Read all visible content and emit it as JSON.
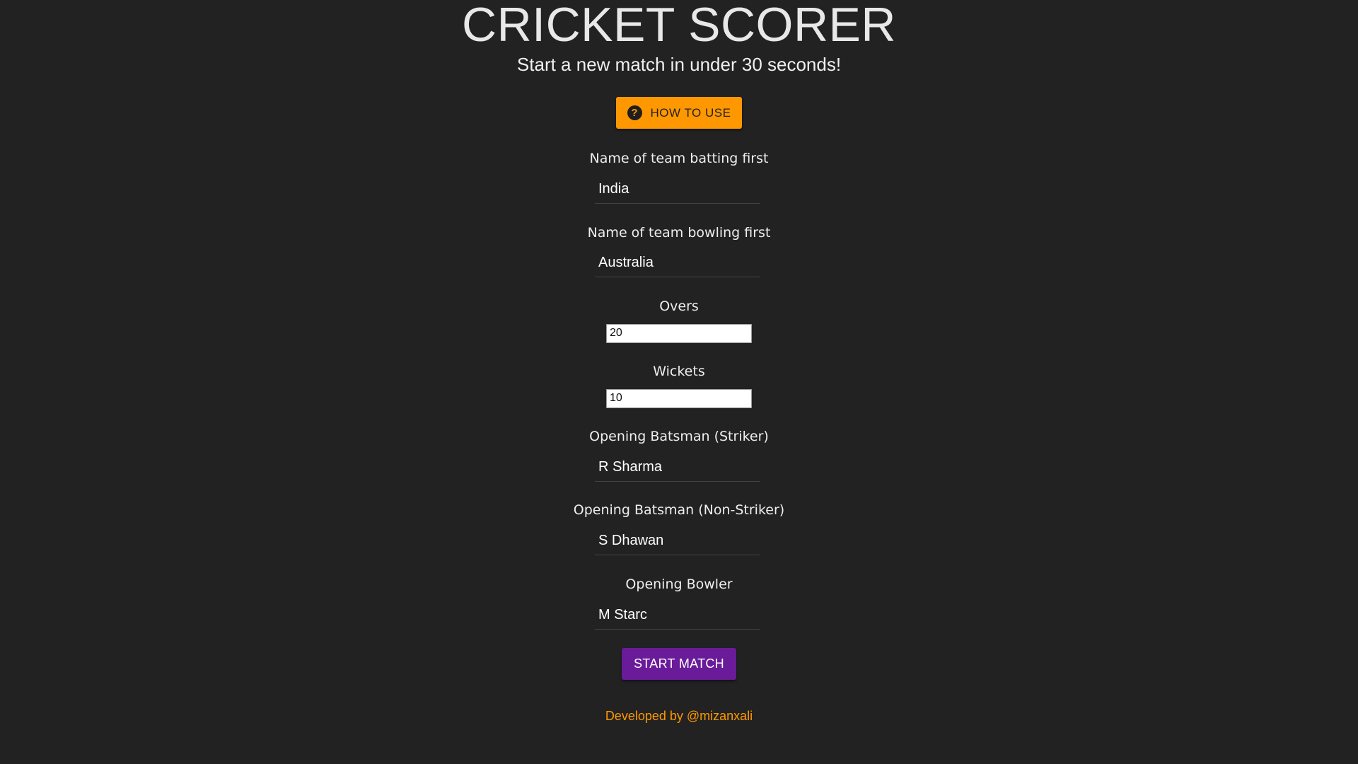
{
  "header": {
    "title": "CRICKET SCORER",
    "subtitle": "Start a new match in under 30 seconds!"
  },
  "how_to_use": {
    "label": "HOW TO USE",
    "icon": "help-circle-icon",
    "glyph": "?"
  },
  "form": {
    "batting_team": {
      "label": "Name of team batting first",
      "value": "India"
    },
    "bowling_team": {
      "label": "Name of team bowling first",
      "value": "Australia"
    },
    "overs": {
      "label": "Overs",
      "value": "20"
    },
    "wickets": {
      "label": "Wickets",
      "value": "10"
    },
    "striker": {
      "label": "Opening Batsman (Striker)",
      "value": "R Sharma"
    },
    "non_striker": {
      "label": "Opening Batsman (Non-Striker)",
      "value": "S Dhawan"
    },
    "bowler": {
      "label": "Opening Bowler",
      "value": "M Starc"
    }
  },
  "start_button": {
    "label": "START MATCH"
  },
  "footer": {
    "text": "Developed by @mizanxali"
  },
  "colors": {
    "background": "#222222",
    "accent_orange": "#ff9800",
    "primary_purple": "#6a1b9a"
  }
}
